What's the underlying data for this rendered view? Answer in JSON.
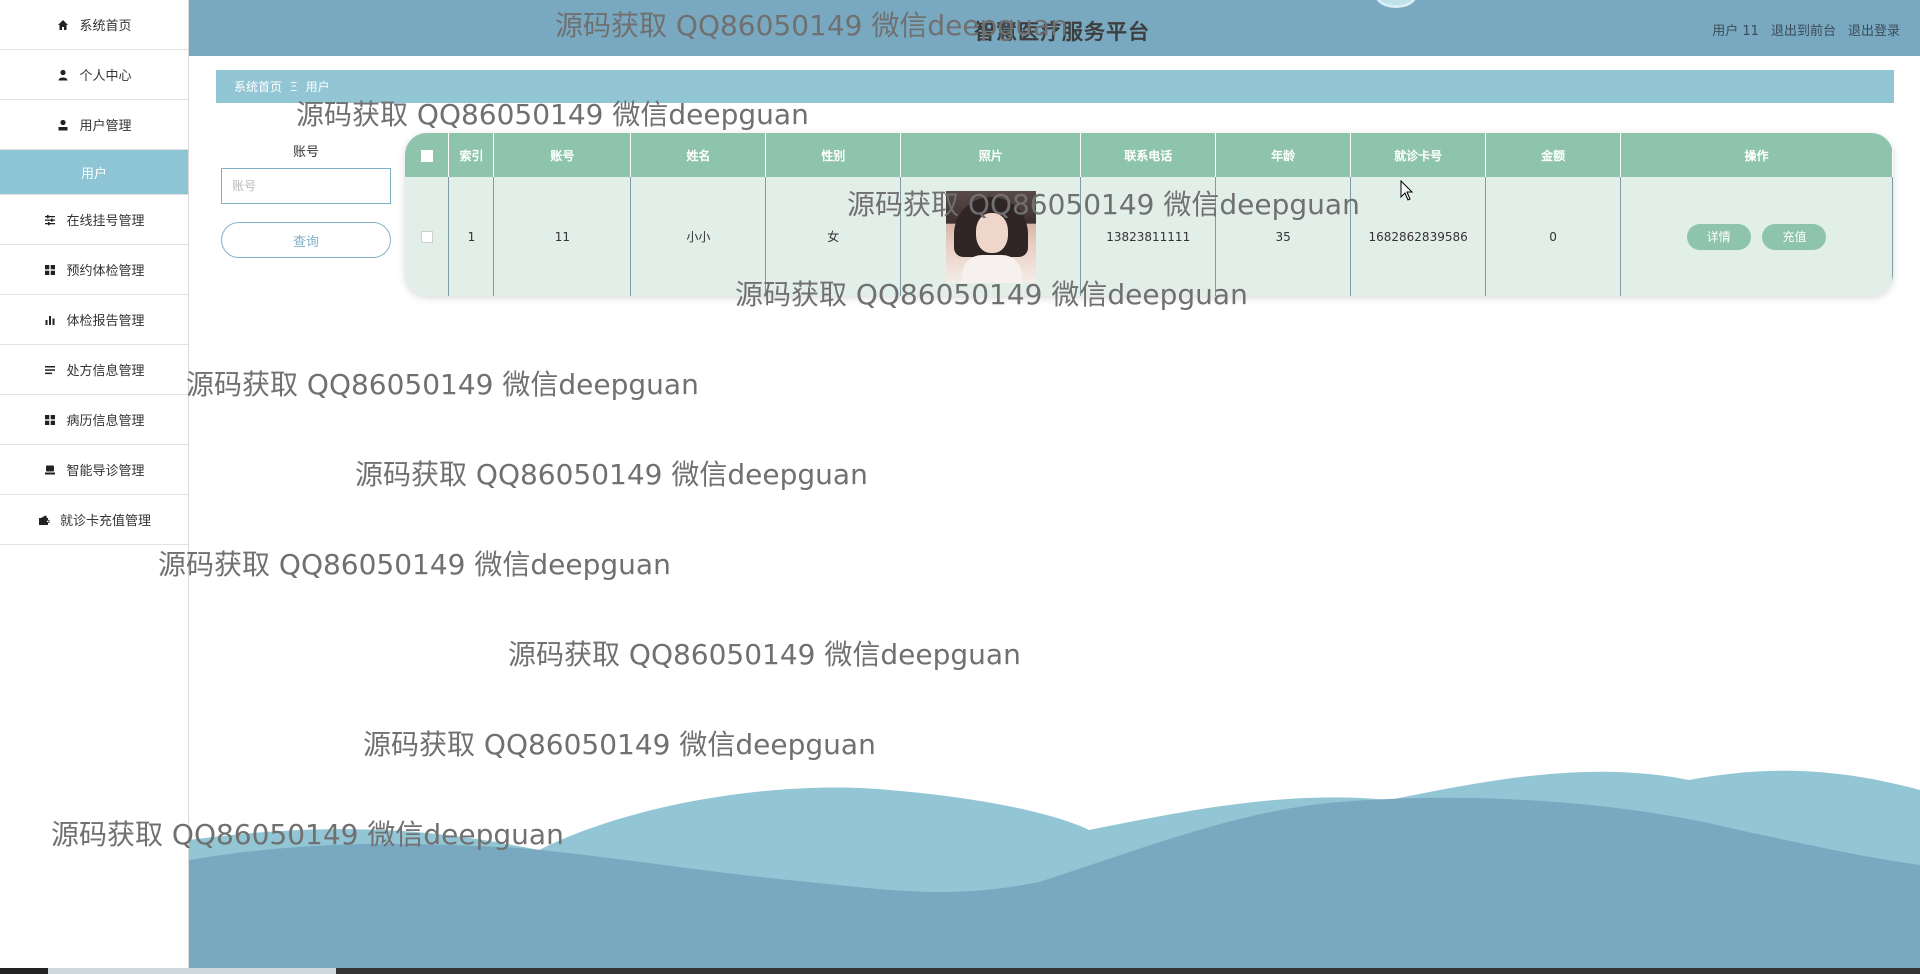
{
  "app": {
    "title": "智慧医疗服务平台",
    "header_links": [
      "用户 11",
      "退出到前台",
      "退出登录"
    ]
  },
  "sidebar": {
    "items": [
      {
        "label": "系统首页",
        "icon": "home-icon"
      },
      {
        "label": "个人中心",
        "icon": "user-icon"
      },
      {
        "label": "用户管理",
        "icon": "user-manage-icon"
      },
      {
        "label": "用户",
        "icon": ""
      },
      {
        "label": "在线挂号管理",
        "icon": "sliders-icon"
      },
      {
        "label": "预约体检管理",
        "icon": "grid-icon"
      },
      {
        "label": "体检报告管理",
        "icon": "bar-chart-icon"
      },
      {
        "label": "处方信息管理",
        "icon": "list-icon"
      },
      {
        "label": "病历信息管理",
        "icon": "grid-icon"
      },
      {
        "label": "智能导诊管理",
        "icon": "printer-icon"
      },
      {
        "label": "就诊卡充值管理",
        "icon": "wallet-icon"
      }
    ]
  },
  "breadcrumb": {
    "home": "系统首页",
    "separator": "Ξ",
    "current": "用户"
  },
  "search": {
    "label": "账号",
    "placeholder": "账号",
    "value": "",
    "button": "查询"
  },
  "table": {
    "headers": [
      "索引",
      "账号",
      "姓名",
      "性别",
      "照片",
      "联系电话",
      "年龄",
      "就诊卡号",
      "金额",
      "操作"
    ],
    "rows": [
      {
        "index": "1",
        "account": "11",
        "name": "小小",
        "gender": "女",
        "phone": "13823811111",
        "age": "35",
        "card_no": "1682862839586",
        "amount": "0",
        "actions": [
          "详情",
          "充值"
        ]
      }
    ]
  },
  "watermark": {
    "text": "源码获取 QQ86050149 微信deepguan"
  },
  "colors": {
    "header": "#79a9c1",
    "breadcrumb": "#93c6d4",
    "table_header": "#8ec4ac",
    "table_body": "#e2efe9",
    "wave_light": "#93c6d4",
    "wave_dark": "#79a9c1"
  }
}
